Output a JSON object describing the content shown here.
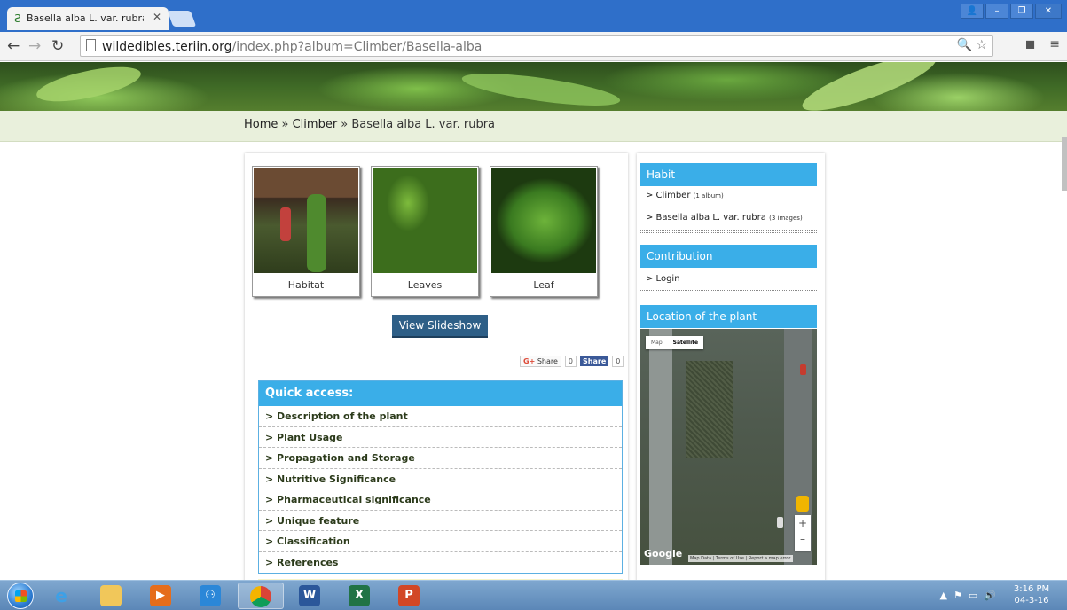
{
  "browser": {
    "tab_title": "Basella alba L. var. rubra |",
    "tab_favicon": "Ƨ",
    "url_host": "wildedibles.teriin.org",
    "url_path": "/index.php?album=Climber/Basella-alba"
  },
  "breadcrumb": {
    "home": "Home",
    "sep1": " » ",
    "climber": "Climber",
    "sep2": " » ",
    "current": "Basella alba L. var. rubra"
  },
  "gallery": {
    "items": [
      {
        "caption": "Habitat"
      },
      {
        "caption": "Leaves"
      },
      {
        "caption": "Leaf"
      }
    ],
    "slideshow_label": "View Slideshow"
  },
  "share": {
    "gplus_label": "Share",
    "gplus_count": "0",
    "fb_label": "Share",
    "fb_count": "0"
  },
  "quick_access": {
    "heading": "Quick access:",
    "items": [
      "> Description of the plant",
      "> Plant Usage",
      "> Propagation and Storage",
      "> Nutritive Significance",
      "> Pharmaceutical significance",
      "> Unique feature",
      "> Classification",
      "> References"
    ]
  },
  "sidebar": {
    "habit": {
      "heading": "Habit",
      "items": [
        {
          "label": "> Climber",
          "count": "(1 album)"
        },
        {
          "label": "> Basella alba L. var. rubra",
          "count": "(3 images)"
        }
      ]
    },
    "contribution": {
      "heading": "Contribution",
      "login": "> Login"
    },
    "location": {
      "heading": "Location of the plant",
      "map_tab": "Map",
      "satellite_tab": "Satellite",
      "google": "Google",
      "footer": "Map Data | Terms of Use | Report a map error",
      "zoom_in": "+",
      "zoom_out": "–"
    }
  },
  "taskbar": {
    "time": "3:16 PM",
    "date": "04-3-16"
  },
  "colors": {
    "accent_blue": "#3aaee8",
    "button_blue": "#2e5f87",
    "breadcrumb_bg": "#e9f0dc"
  }
}
